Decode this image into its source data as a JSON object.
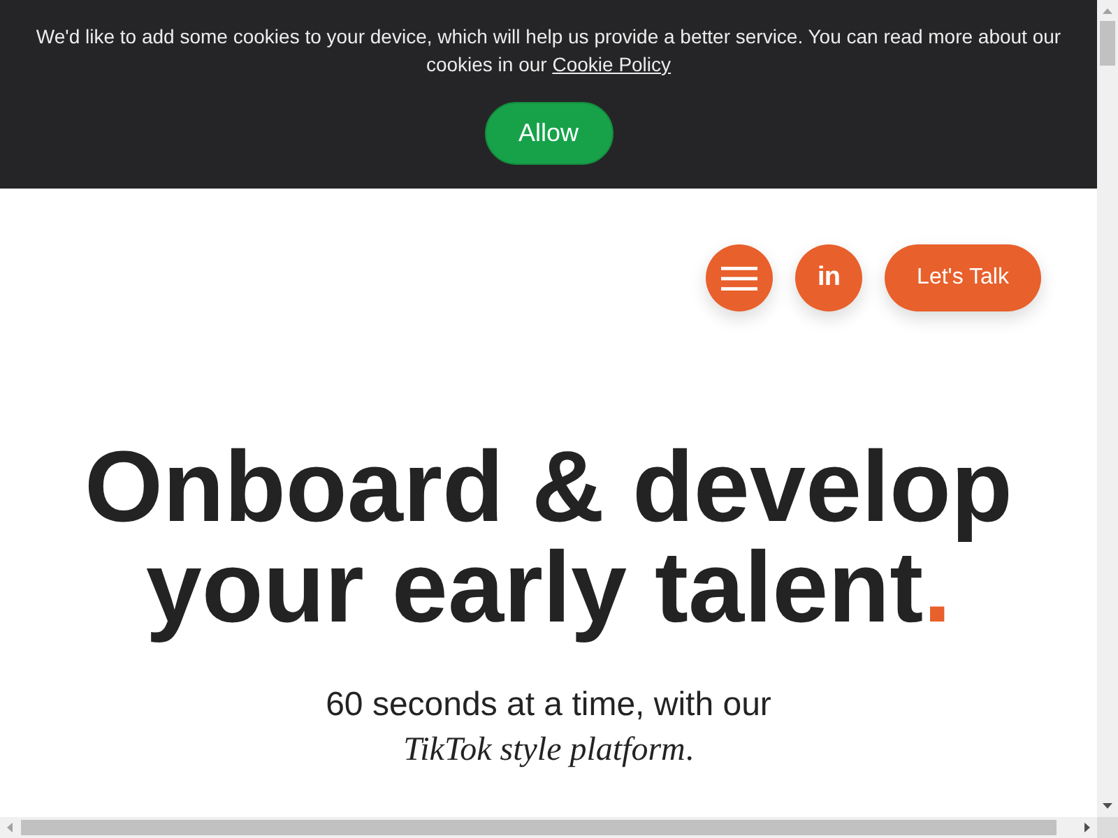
{
  "cookie_banner": {
    "message": "We'd like to add some cookies to your device, which will help us provide a better service. You can read more about our cookies in our ",
    "link": "Cookie Policy",
    "button": "Allow"
  },
  "nav": {
    "social_label": "in",
    "contact_button": "Let's Talk"
  },
  "hero": {
    "headline": "Onboard & develop your early talent",
    "headline_accent": ".",
    "subtitle": "60 seconds at a time, with our",
    "subtitle_emphasis": "*TikTok style platform*."
  }
}
